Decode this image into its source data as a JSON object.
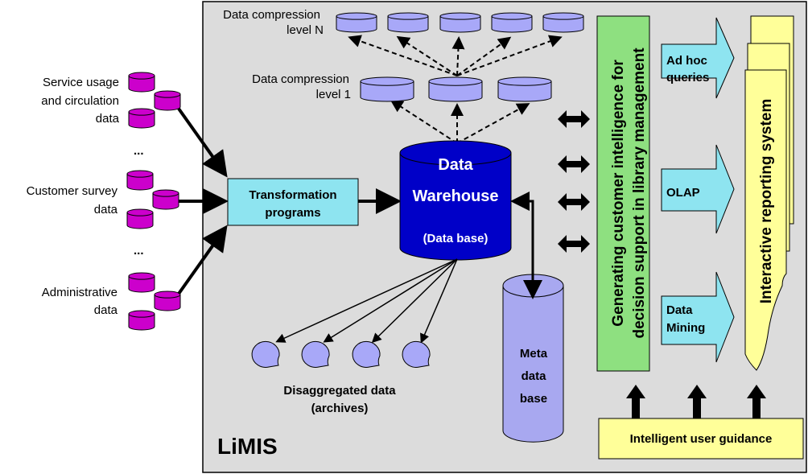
{
  "sources": [
    {
      "lines": [
        "Service usage",
        "and circulation",
        "data"
      ]
    },
    {
      "lines": [
        "Customer survey",
        "data"
      ]
    },
    {
      "lines": [
        "Administrative",
        "data"
      ]
    }
  ],
  "ellipsis": "...",
  "transformation": {
    "lines": [
      "Transformation",
      "programs"
    ]
  },
  "warehouse": {
    "line1": "Data",
    "line2": "Warehouse",
    "line3": "(Data base)"
  },
  "meta": {
    "lines": [
      "Meta",
      "data",
      "base"
    ]
  },
  "compression_n": {
    "lines": [
      "Data compression",
      "level N"
    ]
  },
  "compression_1": {
    "lines": [
      "Data compression",
      "level 1"
    ]
  },
  "disaggregated": {
    "lines": [
      "Disaggregated data",
      "(archives)"
    ]
  },
  "system_name": "LiMIS",
  "intelligence": {
    "lines": [
      "Generating customer intelligence for",
      "decision support in library management"
    ]
  },
  "tools": [
    {
      "lines": [
        "Ad hoc",
        "queries"
      ]
    },
    {
      "lines": [
        "OLAP"
      ]
    },
    {
      "lines": [
        "Data",
        "Mining"
      ]
    }
  ],
  "reporting": "Interactive reporting system",
  "guidance": "Intelligent user guidance",
  "colors": {
    "panel": "#dcdcdc",
    "source_db": "#cc00cc",
    "warehouse": "#0000c8",
    "light_db": "#a8a8f8",
    "cyan": "#8ee4f0",
    "green": "#8ee080",
    "yellow": "#ffff99"
  }
}
